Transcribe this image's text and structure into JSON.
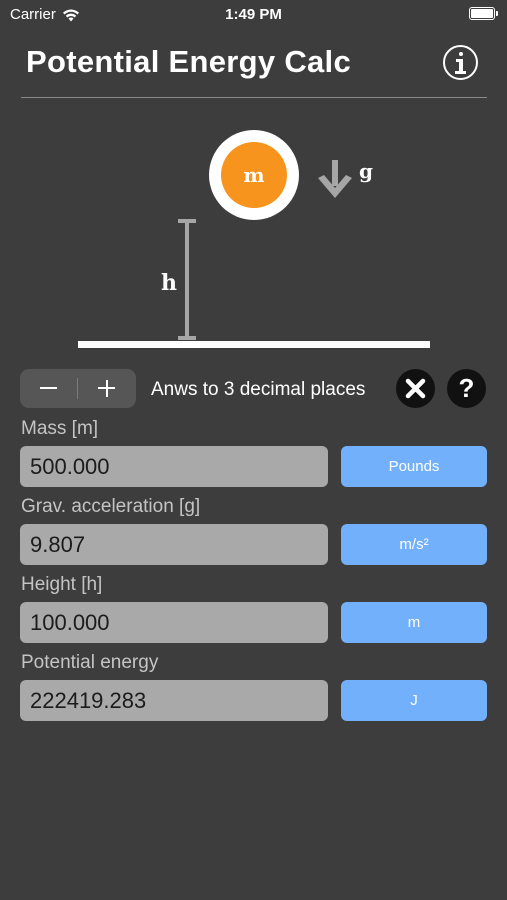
{
  "status_bar": {
    "carrier": "Carrier",
    "time": "1:49 PM"
  },
  "header": {
    "title": "Potential Energy Calc",
    "info_icon": "info-circle-icon"
  },
  "diagram": {
    "mass_symbol": "m",
    "gravity_symbol": "g",
    "height_symbol": "h",
    "mass_color": "#f7941d"
  },
  "controls": {
    "minus_label": "−",
    "plus_label": "+",
    "decimal_text": "Anws to 3 decimal places",
    "help_label": "?"
  },
  "fields": {
    "mass": {
      "label": "Mass [m]",
      "value": "500.000",
      "unit": "Pounds"
    },
    "gravity": {
      "label": "Grav. acceleration [g]",
      "value": "9.807",
      "unit": "m/s²"
    },
    "height": {
      "label": "Height [h]",
      "value": "100.000",
      "unit": "m"
    },
    "energy": {
      "label": "Potential energy",
      "value": "222419.283",
      "unit": "J"
    }
  },
  "colors": {
    "background": "#3d3d3d",
    "field": "#a9a9a9",
    "unit_button": "#73b0fb",
    "accent": "#f7941d"
  }
}
